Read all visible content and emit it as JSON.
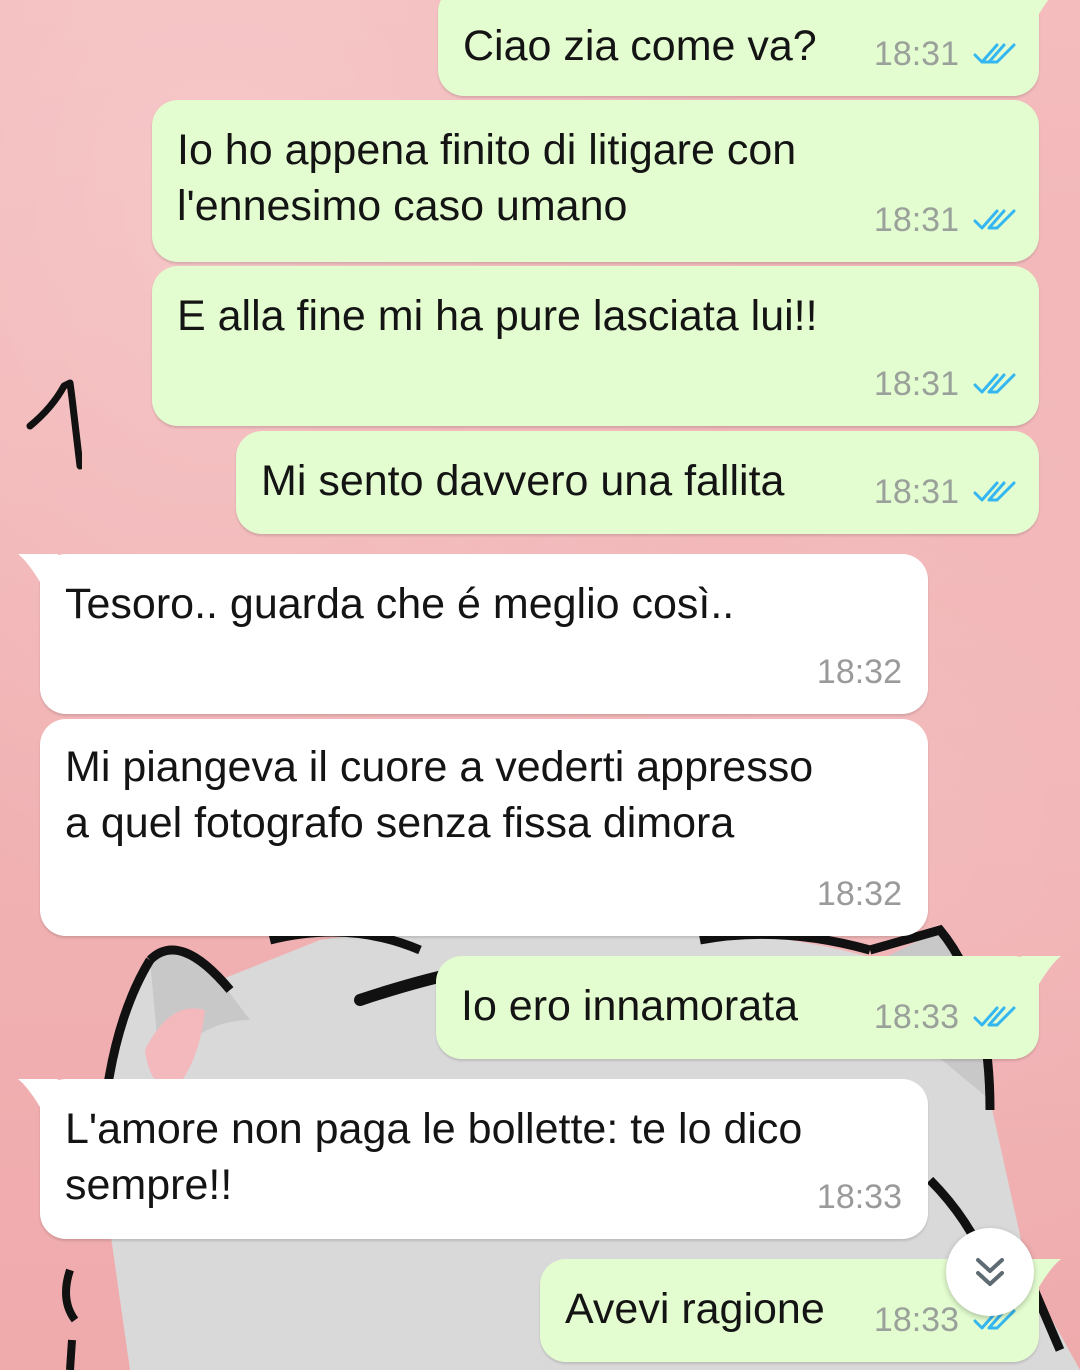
{
  "messages": [
    {
      "direction": "out",
      "text": "Ciao zia come va?",
      "time": "18:31",
      "status": "read"
    },
    {
      "direction": "out",
      "text": "Io ho appena finito di litigare con\nl'ennesimo caso umano",
      "time": "18:31",
      "status": "read"
    },
    {
      "direction": "out",
      "text": "E alla fine mi ha pure lasciata lui!!",
      "time": "18:31",
      "status": "read"
    },
    {
      "direction": "out",
      "text": "Mi sento davvero una fallita",
      "time": "18:31",
      "status": "read"
    },
    {
      "direction": "in",
      "text": "Tesoro.. guarda che é meglio così..",
      "time": "18:32"
    },
    {
      "direction": "in",
      "text": "Mi piangeva il cuore a vederti appresso\na quel fotografo senza fissa dimora",
      "time": "18:32"
    },
    {
      "direction": "out",
      "text": "Io ero innamorata",
      "time": "18:33",
      "status": "read"
    },
    {
      "direction": "in",
      "text": "L'amore non paga le bollette: te lo dico\nsempre!!",
      "time": "18:33"
    },
    {
      "direction": "out",
      "text": "Avevi ragione",
      "time": "18:33",
      "status": "read"
    }
  ],
  "annotation": "1",
  "icons": {
    "read_receipt": "double-check-icon",
    "scroll_down": "chevron-double-down-icon"
  },
  "colors": {
    "outgoing_bubble": "#e3fdd0",
    "incoming_bubble": "#ffffff",
    "read_tick": "#34b7f1",
    "wallpaper": "#f2b3b4"
  }
}
